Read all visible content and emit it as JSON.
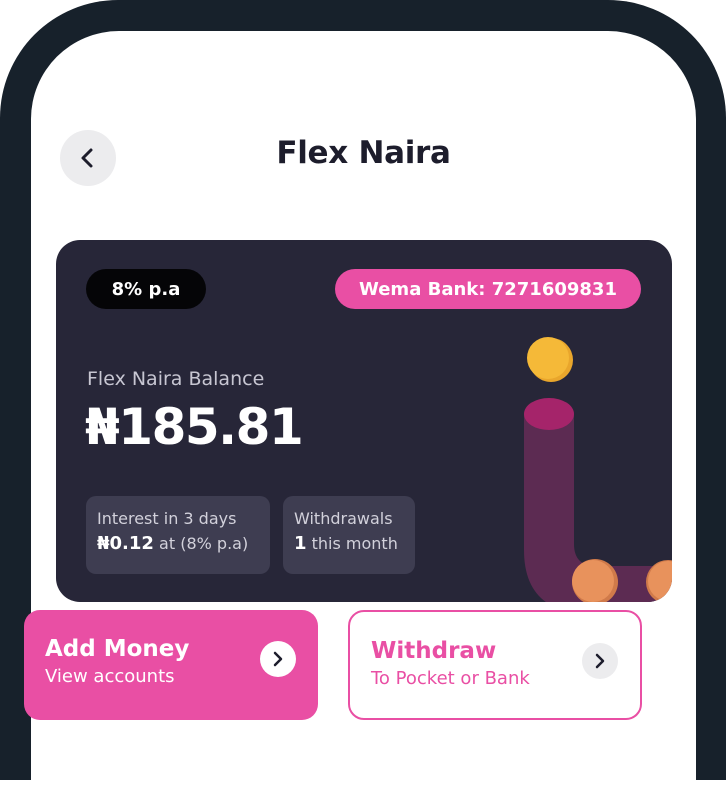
{
  "header": {
    "title": "Flex Naira",
    "back_icon": "chevron-left-icon"
  },
  "balance_card": {
    "rate": "8% p.a",
    "bank_account": "Wema Bank: 7271609831",
    "balance_label": "Flex Naira Balance",
    "balance_amount": "₦185.81",
    "interest": {
      "label": "Interest in 3 days",
      "amount": "₦0.12",
      "note": "at (8% p.a)"
    },
    "withdrawals": {
      "label": "Withdrawals",
      "count": "1",
      "note": "this month"
    }
  },
  "actions": {
    "add_money": {
      "title": "Add Money",
      "subtitle": "View accounts"
    },
    "withdraw": {
      "title": "Withdraw",
      "subtitle": "To Pocket or Bank"
    }
  },
  "colors": {
    "accent_pink": "#e94fa4",
    "card_dark": "#272638",
    "frame": "#17212b",
    "coin_yellow": "#f5b938",
    "coin_orange": "#e8925c"
  }
}
